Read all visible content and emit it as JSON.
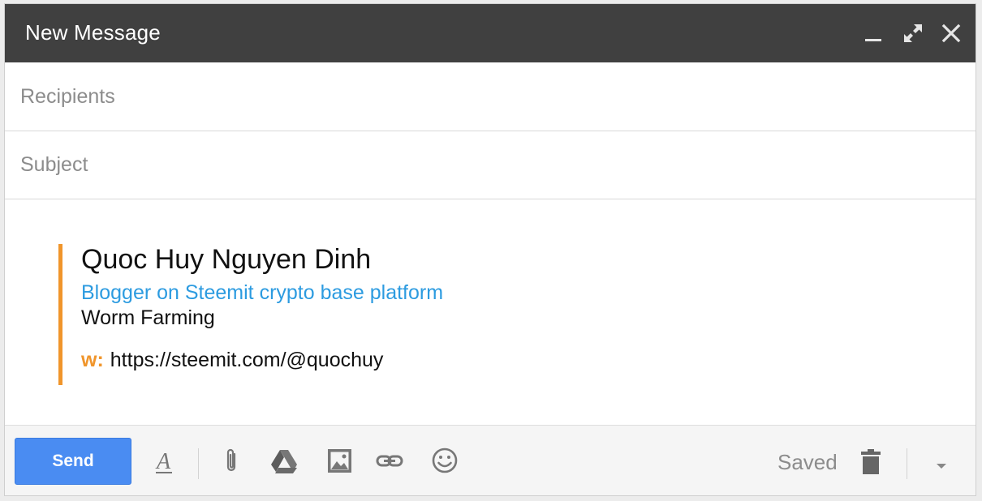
{
  "window": {
    "title": "New Message",
    "controls": [
      "minimize-icon",
      "expand-icon",
      "close-icon"
    ]
  },
  "fields": {
    "recipients_placeholder": "Recipients",
    "recipients_value": "",
    "subject_placeholder": "Subject",
    "subject_value": ""
  },
  "signature": {
    "name": "Quoc Huy Nguyen Dinh",
    "role": "Blogger on Steemit crypto base platform",
    "company": "Worm Farming",
    "web_label": "w:",
    "web_url": "https://steemit.com/@quochuy"
  },
  "toolbar": {
    "send_label": "Send",
    "saved_label": "Saved",
    "icons": [
      "format-text-icon",
      "attachment-icon",
      "drive-icon",
      "photo-icon",
      "link-icon",
      "emoji-icon",
      "trash-icon",
      "more-options-icon"
    ]
  },
  "colors": {
    "titlebar": "#404040",
    "send_button": "#4a8cf2",
    "signature_accent": "#f0952b",
    "signature_role": "#2c9be0"
  }
}
